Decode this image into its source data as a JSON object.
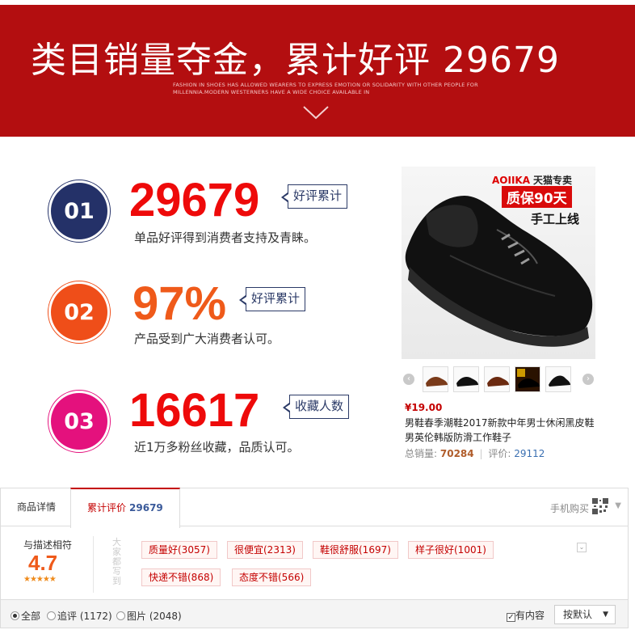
{
  "banner": {
    "title": "类目销量夺金，累计好评 29679",
    "subtitle_line1": "FASHION IN SHOES HAS ALLOWED WEARERS TO EXPRESS EMOTION OR SOLIDARITY WITH OTHER PEOPLE FOR",
    "subtitle_line2": "MILLENNIA.MODERN WESTERNERS HAVE A WIDE CHOICE AVAILABLE IN"
  },
  "stats": [
    {
      "num": "01",
      "value": "29679",
      "tag": "好评累计",
      "desc": "单品好评得到消费者支持及青睐。"
    },
    {
      "num": "02",
      "value": "97%",
      "tag": "好评累计",
      "desc": "产品受到广大消费者认可。"
    },
    {
      "num": "03",
      "value": "16617",
      "tag": "收藏人数",
      "desc": "近1万多粉丝收藏，品质认可。"
    }
  ],
  "product": {
    "brand": "AOIIKA",
    "tmall": "天猫专卖",
    "guarantee": "质保90天",
    "handmade": "手工上线",
    "price": "¥19.00",
    "title": "男鞋春季潮鞋2017新款中年男士休闲黑皮鞋男英伦韩版防滑工作鞋子",
    "sales_label": "总销量:",
    "sales_value": "70284",
    "reviews_label": "评价:",
    "reviews_value": "29112"
  },
  "tabs": {
    "details": "商品详情",
    "reviews": "累计评价",
    "reviews_count": "29679",
    "mobile_buy": "手机购买"
  },
  "review_summary": {
    "label": "与描述相符",
    "score": "4.7",
    "stars": "★★★★★",
    "vertical_text": "大家都写到",
    "tags": [
      "质量好(3057)",
      "很便宜(2313)",
      "鞋很舒服(1697)",
      "样子很好(1001)",
      "快递不错(868)",
      "态度不错(566)"
    ]
  },
  "filter": {
    "all": "全部",
    "followup": "追评 (1172)",
    "pictures": "图片 (2048)",
    "has_content": "有内容",
    "sort": "按默认"
  }
}
